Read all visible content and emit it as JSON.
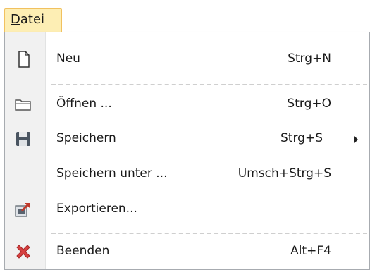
{
  "menubar": {
    "file_menu": {
      "label_hotkey": "D",
      "label_rest": "atei"
    }
  },
  "menu": {
    "items": [
      {
        "label": "Neu",
        "shortcut": "Strg+N",
        "icon": "new-document-icon"
      },
      {
        "label": "Öffnen ...",
        "shortcut": "Strg+O",
        "icon": "open-folder-icon"
      },
      {
        "label": "Speichern",
        "shortcut": "Strg+S",
        "icon": "save-floppy-icon",
        "submenu": true
      },
      {
        "label": "Speichern unter ...",
        "shortcut": "Umsch+Strg+S",
        "icon": ""
      },
      {
        "label": "Exportieren...",
        "shortcut": "",
        "icon": "export-icon"
      },
      {
        "label": "Beenden",
        "shortcut": "Alt+F4",
        "icon": "close-x-icon"
      }
    ]
  },
  "colors": {
    "menubar_highlight": "#fdeeb4",
    "menubar_border": "#f1c15f",
    "gutter": "#f1f1f1",
    "exit_icon": "#d64040"
  }
}
